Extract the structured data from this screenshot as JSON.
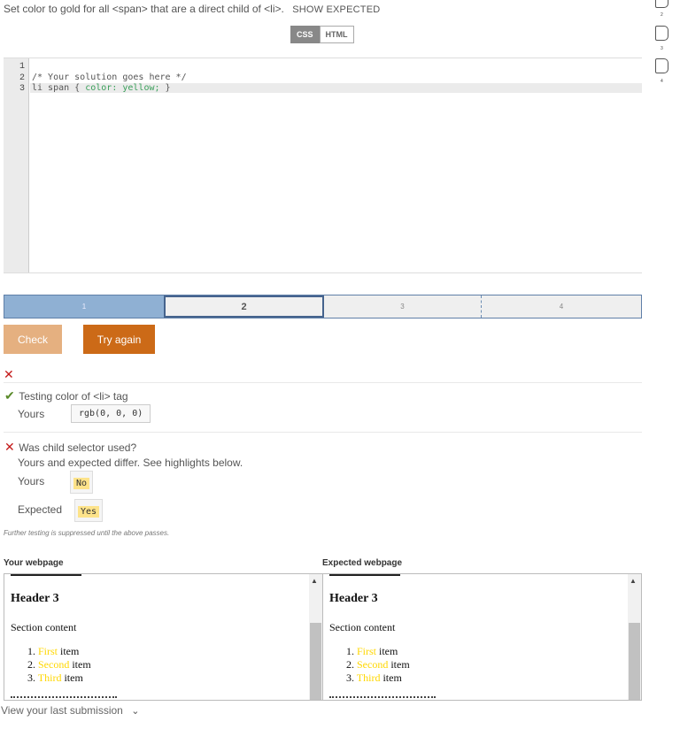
{
  "prompt": {
    "text": "Set color to gold for all <span> that are a direct child of <li>.",
    "show_expected": "SHOW EXPECTED"
  },
  "tabs": [
    "CSS",
    "HTML"
  ],
  "editor": {
    "line_numbers": [
      "1",
      "2",
      "3"
    ],
    "line2": "/* Your solution goes here */",
    "line3_selector": "li span { ",
    "line3_value": "color: yellow;",
    "line3_close": " }"
  },
  "progress": {
    "segments": [
      "1",
      "2",
      "3",
      "4"
    ],
    "current": 2
  },
  "buttons": {
    "check": "Check",
    "try_again": "Try again"
  },
  "results": {
    "test1": {
      "title": "Testing color of <li> tag",
      "yours_label": "Yours",
      "yours_value": "rgb(0, 0, 0)"
    },
    "test2": {
      "title": "Was child selector used?",
      "note": "Yours and expected differ. See highlights below.",
      "yours_label": "Yours",
      "yours_value": "No",
      "expected_label": "Expected",
      "expected_value": "Yes"
    },
    "suppressed": "Further testing is suppressed until the above passes."
  },
  "webpages": {
    "yours_title": "Your webpage",
    "expected_title": "Expected webpage",
    "header": "Header 3",
    "section": "Section content",
    "items": [
      {
        "num": "1.",
        "span": "First",
        "rest": " item"
      },
      {
        "num": "2.",
        "span": "Second",
        "rest": " item"
      },
      {
        "num": "3.",
        "span": "Third",
        "rest": " item"
      }
    ]
  },
  "footer": {
    "text": "View your last submission"
  },
  "sidenav": [
    "2",
    "3",
    "4"
  ],
  "colors": {
    "accent": "#cc6a17",
    "check_button": "#e5b080",
    "progress_done": "#8fb0d3",
    "highlight": "#fde38a",
    "gold": "#ffd700"
  }
}
